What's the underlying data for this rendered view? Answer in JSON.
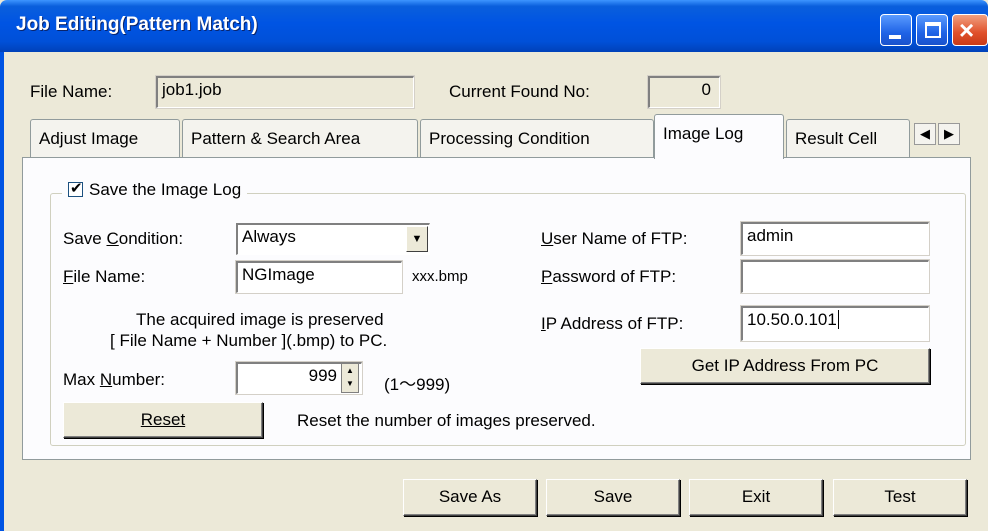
{
  "window": {
    "title": "Job Editing(Pattern Match)",
    "buttons": {
      "minimize": "minimize-icon",
      "maximize": "maximize-icon",
      "close": "×"
    }
  },
  "header": {
    "file_name_label": "File Name:",
    "file_name_value": "job1.job",
    "found_label": "Current Found No:",
    "found_value": "0"
  },
  "tabs": [
    {
      "label": "Adjust Image"
    },
    {
      "label": "Pattern & Search Area"
    },
    {
      "label": "Processing Condition"
    },
    {
      "label": "Image Log",
      "active": true
    },
    {
      "label": "Result Cell"
    }
  ],
  "tab_scroll": {
    "left": "◀",
    "right": "▶"
  },
  "image_log": {
    "save_checkbox_label": "Save the Image Log",
    "save_checked": true,
    "save_condition_label": "Save Condition:",
    "save_condition_value": "Always",
    "file_name_label": "File Name:",
    "file_name_value": "NGImage",
    "file_ext": "xxx.bmp",
    "note_line1": "The acquired image is preserved",
    "note_line2": "[ File Name + Number ](.bmp) to PC.",
    "max_number_label": "Max Number:",
    "max_number_value": "999",
    "max_range": "(1～999)",
    "reset_button": "Reset",
    "reset_text": "Reset the number of images preserved.",
    "ftp_user_label": "User Name of FTP:",
    "ftp_user_value": "admin",
    "ftp_password_label": "Password of FTP:",
    "ftp_password_value": "",
    "ftp_ip_label": "IP Address of FTP:",
    "ftp_ip_value": "10.50.0.101",
    "get_ip_button": "Get IP Address From PC"
  },
  "footer": {
    "save_as": "Save As",
    "save": "Save",
    "exit": "Exit",
    "test": "Test"
  }
}
